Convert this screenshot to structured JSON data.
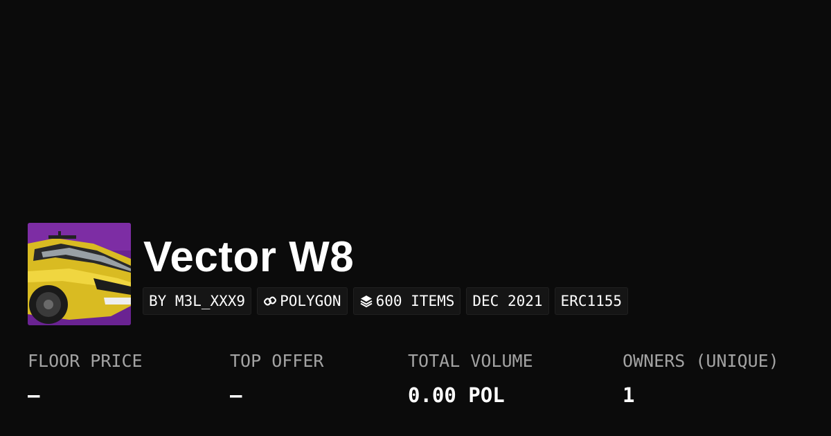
{
  "collection": {
    "name": "Vector W8"
  },
  "chips": {
    "creator": "BY M3L_XXX9",
    "chain": "POLYGON",
    "chain_icon": "chain-link-icon",
    "items": "600 ITEMS",
    "items_icon": "layers-icon",
    "date": "DEC 2021",
    "standard": "ERC1155"
  },
  "stats": {
    "floor_price": {
      "label": "FLOOR PRICE",
      "value": "–"
    },
    "top_offer": {
      "label": "TOP OFFER",
      "value": "–"
    },
    "total_volume": {
      "label": "TOTAL VOLUME",
      "value": "0.00 POL"
    },
    "owners": {
      "label": "OWNERS (UNIQUE)",
      "value": "1"
    }
  },
  "colors": {
    "background": "#0b0b0b",
    "chip_background": "#151515",
    "label_gray": "#a3a3a3",
    "thumbnail_accent": "#7a2aa0",
    "car_yellow": "#e6c82a"
  }
}
